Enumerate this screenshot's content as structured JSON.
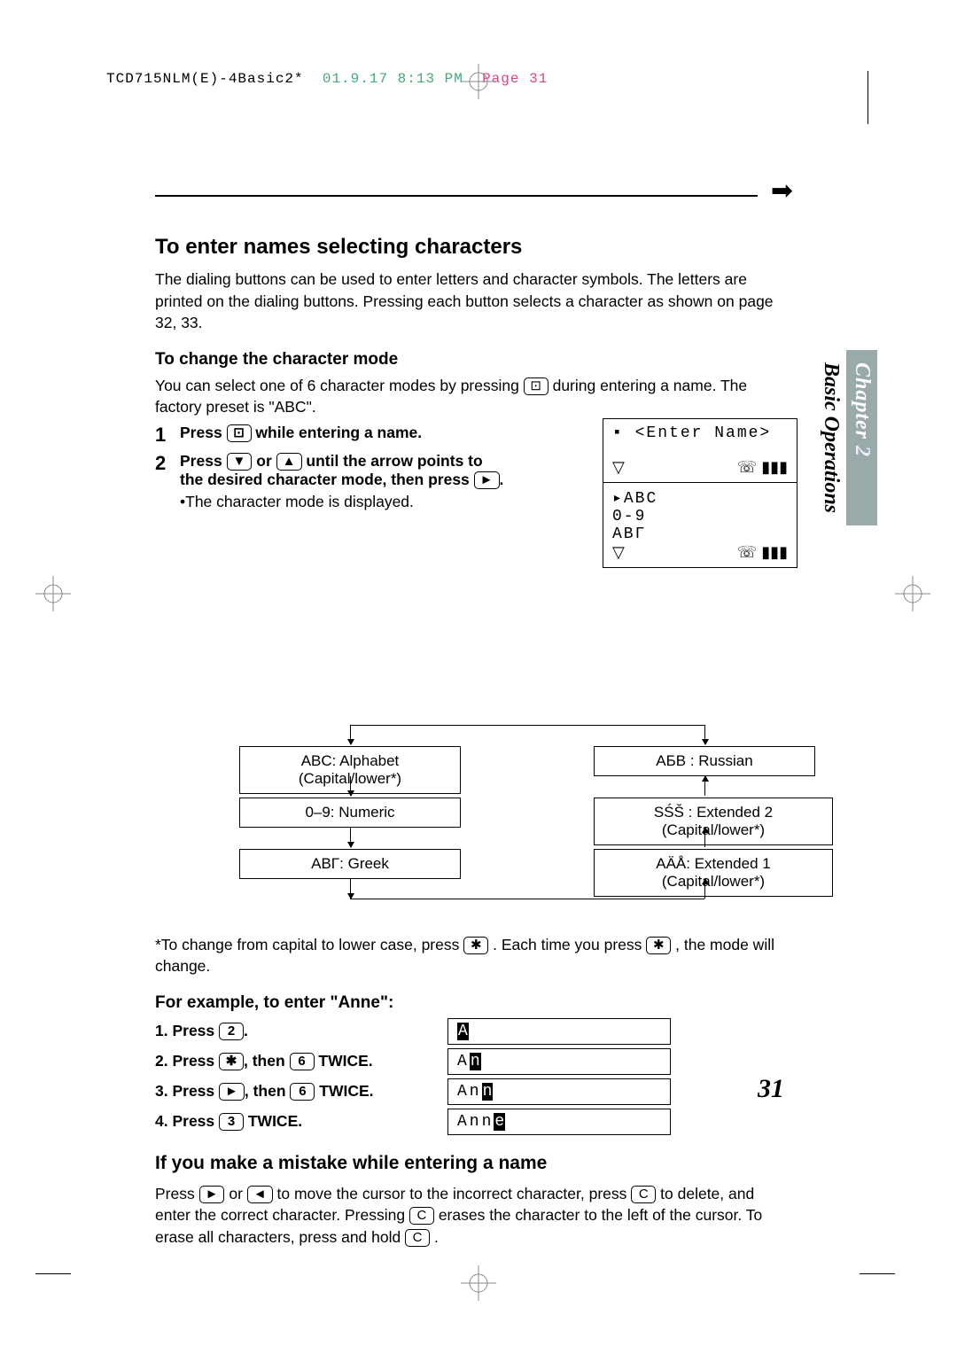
{
  "header": {
    "file": "TCD715NLM(E)-4Basic2*",
    "date": "01.9.17 8:13 PM",
    "page_label": "Page 31"
  },
  "side_tab": {
    "chapter_word": "Chapter",
    "chapter_num": "2",
    "section": "Basic Operations"
  },
  "section": {
    "title": "To enter names selecting characters",
    "intro": "The dialing buttons can be used to enter letters and character symbols. The letters are printed on the dialing buttons. Pressing each button selects a character as shown on page 32, 33.",
    "change_mode_heading": "To change the character mode",
    "change_mode_body_1": "You can select one of 6 character modes by pressing ",
    "change_mode_body_2": " during entering a name. The factory preset is \"ABC\".",
    "steps": [
      {
        "num": "1",
        "pre": "Press ",
        "post": " while entering a name."
      },
      {
        "num": "2",
        "pre": "Press ",
        "mid": " or ",
        "mid2": " until the arrow points to the desired character mode, then press ",
        "post": ".",
        "sub": "•The character mode is displayed."
      }
    ],
    "lcd": {
      "enter_name": "<Enter Name>",
      "line1": "▸ABC",
      "line2": " 0-9",
      "line3": " ΑΒΓ"
    },
    "modes": {
      "left": [
        "ABC: Alphabet (Capital/lower*)",
        "0–9: Numeric",
        "ΑΒΓ: Greek"
      ],
      "right": [
        "АБВ : Russian",
        "SŚŠ : Extended 2 (Capital/lower*)",
        "AÄÅ: Extended 1 (Capital/lower*)"
      ]
    },
    "footnote_pre": "*To change from capital to lower case, press ",
    "footnote_mid": ". Each time you press ",
    "footnote_post": ", the mode will change.",
    "example_heading": "For example, to enter \"Anne\":",
    "example": [
      {
        "step_pre": "1. Press ",
        "k": "2",
        "step_post": ".",
        "display_plain": "",
        "display_cursor": "A"
      },
      {
        "step_pre": "2. Press ",
        "k": "✱",
        "mid": ", then ",
        "k2": "6",
        "step_post": " TWICE.",
        "display_plain": "A",
        "display_cursor": "n"
      },
      {
        "step_pre": "3. Press ",
        "k": "►",
        "mid": ", then ",
        "k2": "6",
        "step_post": " TWICE.",
        "display_plain": "An",
        "display_cursor": "n"
      },
      {
        "step_pre": "4. Press ",
        "k": "3",
        "step_post": " TWICE.",
        "display_plain": "Ann",
        "display_cursor": "e"
      }
    ],
    "mistake_heading": "If you make a mistake while entering a name",
    "mistake_p1_a": "Press ",
    "mistake_p1_b": " or ",
    "mistake_p1_c": " to move the cursor to the incorrect character, press ",
    "mistake_p1_d": " to delete, and enter the correct character. Pressing ",
    "mistake_p1_e": " erases the character to the left of the cursor. To erase all characters, press and hold ",
    "mistake_p1_f": "."
  },
  "keys": {
    "book": "⊡",
    "down": "▼",
    "up": "▲",
    "right": "►",
    "left": "◄",
    "star": "✱",
    "c": "C",
    "k2": "2",
    "k3": "3",
    "k6": "6"
  },
  "page_number": "31"
}
